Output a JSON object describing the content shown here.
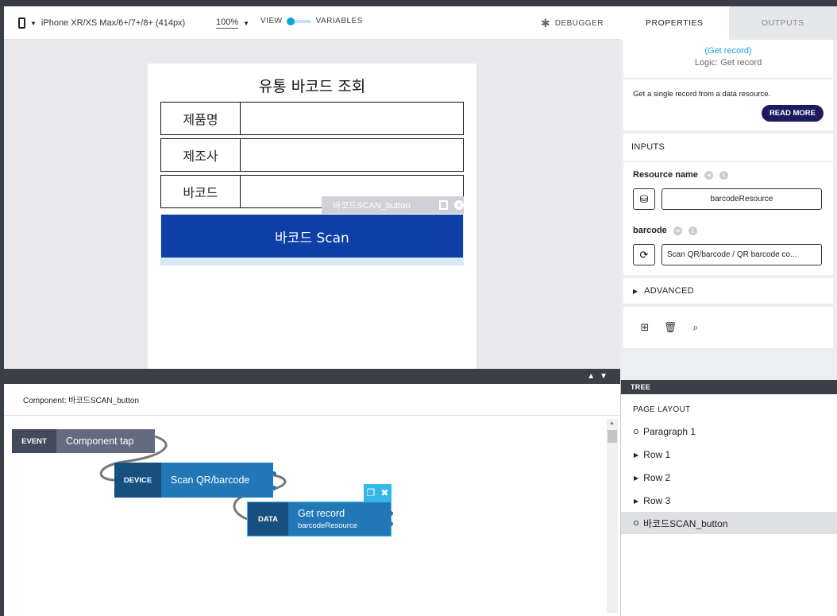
{
  "toolbar": {
    "device": "iPhone XR/XS Max/6+/7+/8+ (414px)",
    "zoom": "100%",
    "view_label": "VIEW",
    "variables_label": "VARIABLES",
    "debugger_label": "DEBUGGER"
  },
  "app": {
    "title": "유통 바코드 조회",
    "rows": [
      {
        "label": "제품명"
      },
      {
        "label": "제조사"
      },
      {
        "label": "바코드"
      }
    ],
    "scan_button": "바코드 Scan",
    "selected_tag": "바코드SCAN_button"
  },
  "logic": {
    "component_header": "Component: 바코드SCAN_button",
    "event": {
      "tag": "EVENT",
      "label": "Component tap"
    },
    "device": {
      "tag": "DEVICE",
      "label": "Scan QR/barcode"
    },
    "data": {
      "tag": "DATA",
      "label": "Get record",
      "sub": "barcodeResource"
    }
  },
  "panel": {
    "tabs": [
      "PROPERTIES",
      "OUTPUTS"
    ],
    "block_link": "(Get record)",
    "block_sub": "Logic: Get record",
    "description": "Get a single record from a data resource.",
    "read_more": "READ MORE",
    "inputs_label": "INPUTS",
    "resource_name_label": "Resource name",
    "resource_value": "barcodeResource",
    "barcode_label": "barcode",
    "barcode_value": "Scan QR/barcode / QR barcode co...",
    "advanced_label": "ADVANCED"
  },
  "tree": {
    "header": "TREE",
    "page_layout": "PAGE LAYOUT",
    "items": [
      "Paragraph 1",
      "Row 1",
      "Row 2",
      "Row 3",
      "바코드SCAN_button"
    ]
  },
  "colors": {
    "scan_button": "#0d3fa6",
    "logic_blue": "#2278b6",
    "accent_cyan": "#35b7ec",
    "read_more": "#1e1a5e"
  }
}
